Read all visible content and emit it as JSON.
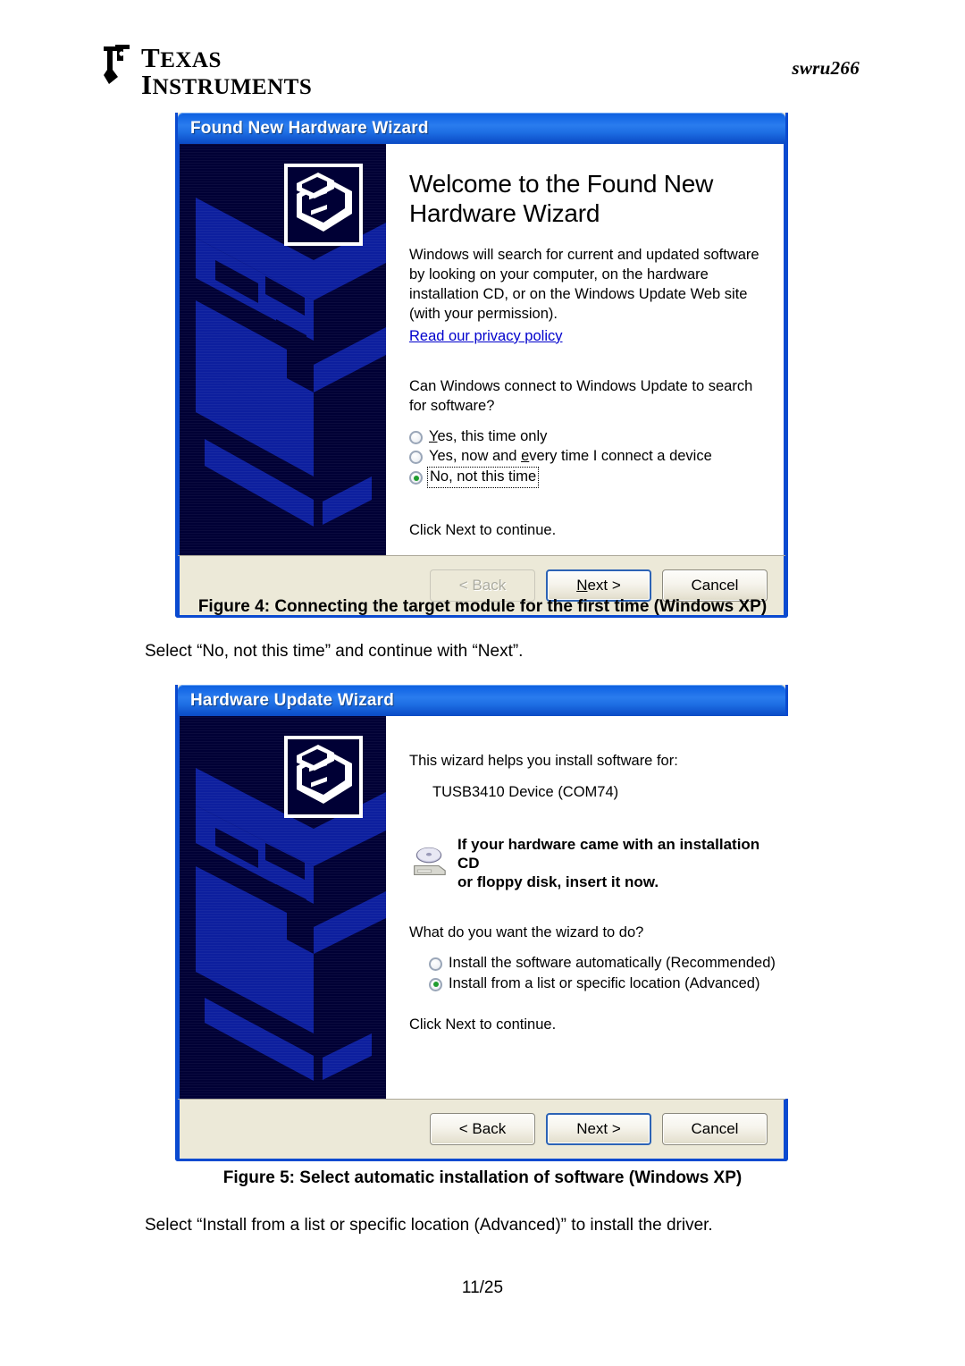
{
  "document": {
    "brand_line1": "Texas",
    "brand_line2": "Instruments",
    "doc_id": "swru266",
    "page_number": "11/25"
  },
  "figure4": {
    "caption": "Figure 4: Connecting the target module for the first time (Windows XP)",
    "following_text": "Select “No, not this time” and continue with “Next”."
  },
  "figure5": {
    "caption": "Figure 5: Select automatic installation of software (Windows XP)",
    "following_text": "Select “Install from a list or specific location (Advanced)” to install the driver."
  },
  "dialog1": {
    "title": "Found New Hardware Wizard",
    "heading": "Welcome to the Found New Hardware Wizard",
    "para1": "Windows will search for current and updated software by looking on your computer, on the hardware installation CD, or on the Windows Update Web site (with your permission).",
    "link": "Read our privacy policy",
    "question": "Can Windows connect to Windows Update to search for software?",
    "options": [
      {
        "label": "Yes, this time only",
        "checked": false,
        "focused": false
      },
      {
        "label": "Yes, now and every time I connect a device",
        "checked": false,
        "focused": false
      },
      {
        "label": "No, not this time",
        "checked": true,
        "focused": true
      }
    ],
    "hint": "Click Next to continue.",
    "buttons": {
      "back": "< Back",
      "next": "Next >",
      "cancel": "Cancel"
    }
  },
  "dialog2": {
    "title": "Hardware Update Wizard",
    "intro": "This wizard helps you install software for:",
    "device": "TUSB3410 Device (COM74)",
    "cd_notice_line1": "If your hardware came with an installation CD",
    "cd_notice_line2": "or floppy disk, insert it now.",
    "question": "What do you want the wizard to do?",
    "options": [
      {
        "label": "Install the software automatically (Recommended)",
        "checked": false
      },
      {
        "label": "Install from a list or specific location (Advanced)",
        "checked": true
      }
    ],
    "hint": "Click Next to continue.",
    "buttons": {
      "back": "< Back",
      "next": "Next >",
      "cancel": "Cancel"
    }
  },
  "colors": {
    "titlebar_blue": "#1568e6",
    "dialog_border": "#0a4ad0",
    "button_face": "#ece9d8",
    "sidebar_navy": "#000035",
    "sidebar_graphic": "#0d1f9e",
    "link_blue": "#0000cc",
    "radio_green": "#1f9c2e"
  }
}
